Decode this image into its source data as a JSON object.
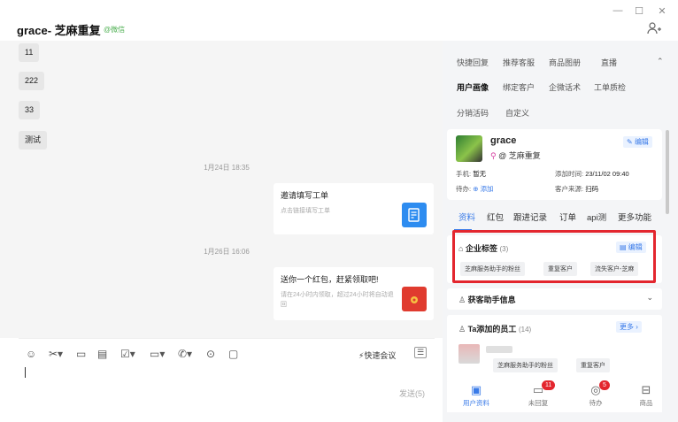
{
  "window": {
    "minimize": "—",
    "maximize": "☐",
    "close": "✕"
  },
  "header": {
    "title": "grace- 芝麻重复",
    "wechat": "@微信"
  },
  "chat": {
    "bubbles": [
      "11",
      "222",
      "33",
      "测试"
    ],
    "ts1": "1月24日 18:35",
    "card1": {
      "title": "邀请填写工单",
      "sub": "点击链接填写工单"
    },
    "ts2": "1月26日 16:06",
    "card2": {
      "title": "送你一个红包，赶紧领取吧!",
      "sub": "请在24小时内领取，超过24小时将自动退回"
    }
  },
  "input": {
    "meet": "快速会议",
    "send": "发送(5)"
  },
  "right": {
    "tabs1": [
      "快捷回复",
      "推荐客服",
      "商品图册",
      "直播"
    ],
    "tabs2": [
      "用户画像",
      "绑定客户",
      "企微话术",
      "工单质检"
    ],
    "tabs3": [
      "分销活码",
      "自定义"
    ],
    "profile": {
      "name": "grace",
      "company": "@ 芝麻重复",
      "edit": "编辑",
      "phone_l": "手机:",
      "phone_v": "暂无",
      "add_l": "添加时间:",
      "add_v": "23/11/02 09:40",
      "todo_l": "待办:",
      "todo_v": "添加",
      "src_l": "客户来源:",
      "src_v": "扫码"
    },
    "subtabs": [
      "资料",
      "红包",
      "跟进记录",
      "订单",
      "api测",
      "更多功能"
    ],
    "tags": {
      "title": "企业标签",
      "count": "(3)",
      "edit": "编辑",
      "items": [
        "芝麻服务助手的粉丝",
        "重复客户",
        "流失客户-芝麻"
      ]
    },
    "assistant": {
      "title": "获客助手信息"
    },
    "staff": {
      "title": "Ta添加的员工",
      "count": "(14)",
      "more": "更多 ›",
      "tags": [
        "芝麻服务助手的粉丝",
        "重复客户"
      ]
    },
    "bottom": [
      {
        "label": "用户资料"
      },
      {
        "label": "未回复",
        "badge": "11"
      },
      {
        "label": "待办",
        "badge": "5"
      },
      {
        "label": "商品"
      }
    ]
  }
}
